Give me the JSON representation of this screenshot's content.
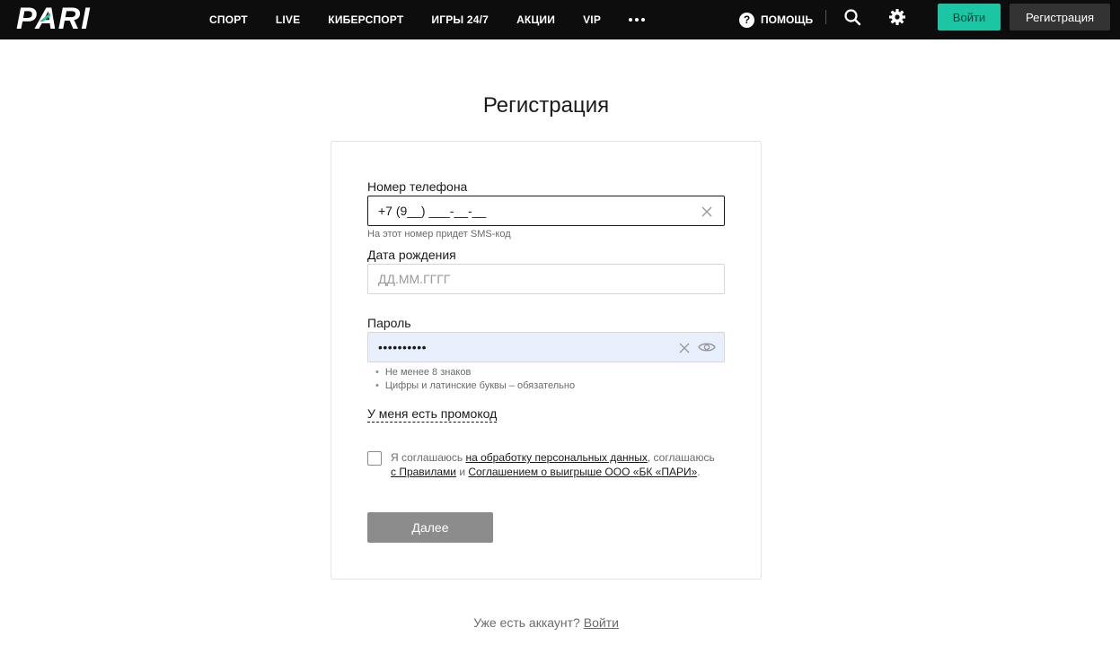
{
  "header": {
    "logo_text": "PARI",
    "nav": [
      {
        "label": "СПОРТ"
      },
      {
        "label": "LIVE"
      },
      {
        "label": "КИБЕРСПОРТ"
      },
      {
        "label": "ИГРЫ 24/7"
      },
      {
        "label": "АКЦИИ"
      },
      {
        "label": "VIP"
      }
    ],
    "more_icon": "more-dots-icon",
    "help_label": "ПОМОЩЬ",
    "help_icon": "question-circle-icon",
    "search_icon": "search-icon",
    "settings_icon": "gear-icon",
    "login_label": "Войти",
    "register_label": "Регистрация",
    "login_color": "#1bc6a5"
  },
  "page": {
    "title": "Регистрация"
  },
  "form": {
    "phone": {
      "label": "Номер телефона",
      "value": "+7 (9__) ___-__-__",
      "hint": "На этот номер придет SMS-код"
    },
    "birthdate": {
      "label": "Дата рождения",
      "value": "",
      "placeholder": "ДД.ММ.ГГГГ"
    },
    "password": {
      "label": "Пароль",
      "value": "••••••••••",
      "rules": [
        "Не менее 8 знаков",
        "Цифры и латинские буквы – обязательно"
      ]
    },
    "promo_label": "У меня есть промокод",
    "consent": {
      "checked": false,
      "text_1": "Я соглашаюсь ",
      "link_1": "на обработку персональных данных",
      "text_2": ", соглашаюсь ",
      "link_2": "с Правилами",
      "text_3": " и ",
      "link_3": "Соглашением о выигрыше ООО «БК «ПАРИ»",
      "text_4": "."
    },
    "submit_label": "Далее",
    "submit_color": "#8c8c8c"
  },
  "footer": {
    "question": "Уже есть аккаунт? ",
    "login_link": "Войти"
  }
}
